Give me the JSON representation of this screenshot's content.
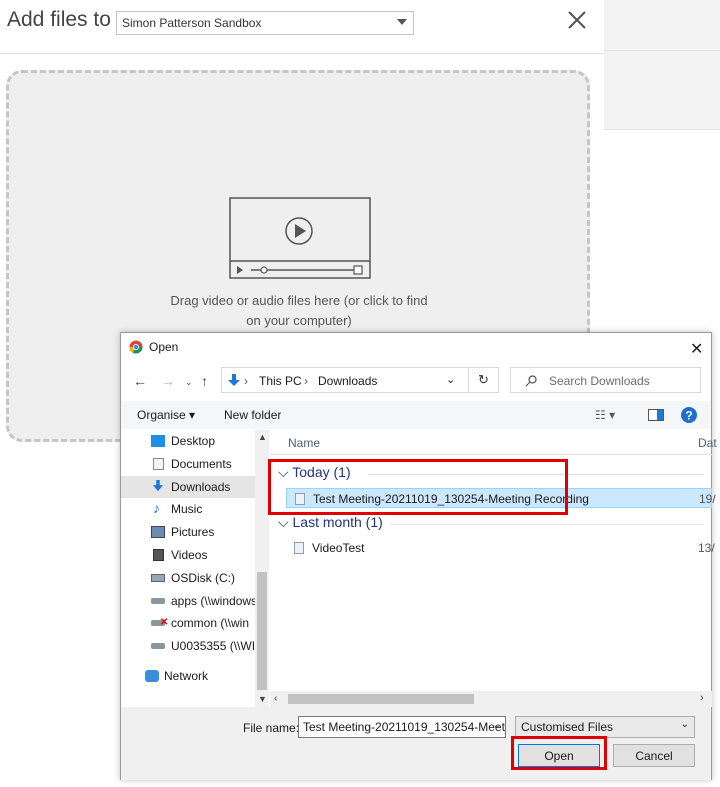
{
  "app": {
    "title_prefix": "Add files to",
    "channel_select": "Simon Patterson Sandbox",
    "drop_text_line1": "Drag video or audio files here (or click to find",
    "drop_text_line2": "on your computer)"
  },
  "dialog": {
    "title": "Open",
    "breadcrumb": [
      "This PC",
      "Downloads"
    ],
    "search_placeholder": "Search Downloads",
    "toolbar": {
      "organise": "Organise ▾",
      "new_folder": "New folder"
    },
    "nav_items": [
      {
        "label": "Desktop",
        "icon": "desktop-icon"
      },
      {
        "label": "Documents",
        "icon": "documents-icon"
      },
      {
        "label": "Downloads",
        "icon": "downloads-icon",
        "selected": true
      },
      {
        "label": "Music",
        "icon": "music-icon"
      },
      {
        "label": "Pictures",
        "icon": "pictures-icon"
      },
      {
        "label": "Videos",
        "icon": "videos-icon"
      },
      {
        "label": "OSDisk (C:)",
        "icon": "drive-icon"
      },
      {
        "label": "apps (\\\\windows",
        "icon": "network-drive-icon"
      },
      {
        "label": "common (\\\\win",
        "icon": "disconnected-drive-icon"
      },
      {
        "label": "U0035355 (\\\\WIN",
        "icon": "network-drive-icon"
      },
      {
        "label": "Network",
        "icon": "network-icon"
      }
    ],
    "columns": {
      "name": "Name",
      "date": "Dat"
    },
    "groups": [
      {
        "label": "Today (1)",
        "files": [
          {
            "name": "Test Meeting-20211019_130254-Meeting Recording",
            "date": "19/",
            "selected": true
          }
        ]
      },
      {
        "label": "Last month (1)",
        "files": [
          {
            "name": "VideoTest",
            "date": "13/",
            "selected": false
          }
        ]
      }
    ],
    "file_name_label": "File name:",
    "file_name_value": "Test Meeting-20211019_130254-Meet",
    "filter_value": "Customised Files",
    "open_button": "Open",
    "cancel_button": "Cancel"
  },
  "colors": {
    "highlight": "#e00000",
    "selection": "#cce8ff",
    "accent": "#0078d7"
  }
}
